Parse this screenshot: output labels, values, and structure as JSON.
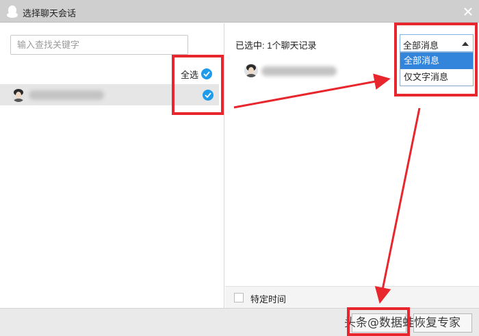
{
  "window": {
    "title": "选择聊天会话",
    "icon": "qq-penguin-icon",
    "close_icon": "close-icon"
  },
  "left_pane": {
    "search": {
      "value": "",
      "placeholder": "输入查找关键字"
    },
    "select_all_label": "全选",
    "select_all_checked": true,
    "contacts": [
      {
        "avatar": "avatar",
        "name_blurred": true,
        "checked": true
      }
    ]
  },
  "right_pane": {
    "selected_count_text": "已选中: 1个聊天记录",
    "filter": {
      "selected": "全部消息",
      "options": [
        "全部消息",
        "仅文字消息"
      ],
      "highlighted_index": 0
    },
    "specific_time": {
      "label": "特定时间",
      "checked": false
    }
  },
  "footer": {
    "watermark": "头条@数据蛙恢复专家"
  },
  "colors": {
    "titlebar": "#cfcfcf",
    "check_blue": "#1e9bea",
    "dropdown_highlight": "#3285db",
    "annotation_red": "#e8262d",
    "row_selected": "#e6e6e6"
  }
}
